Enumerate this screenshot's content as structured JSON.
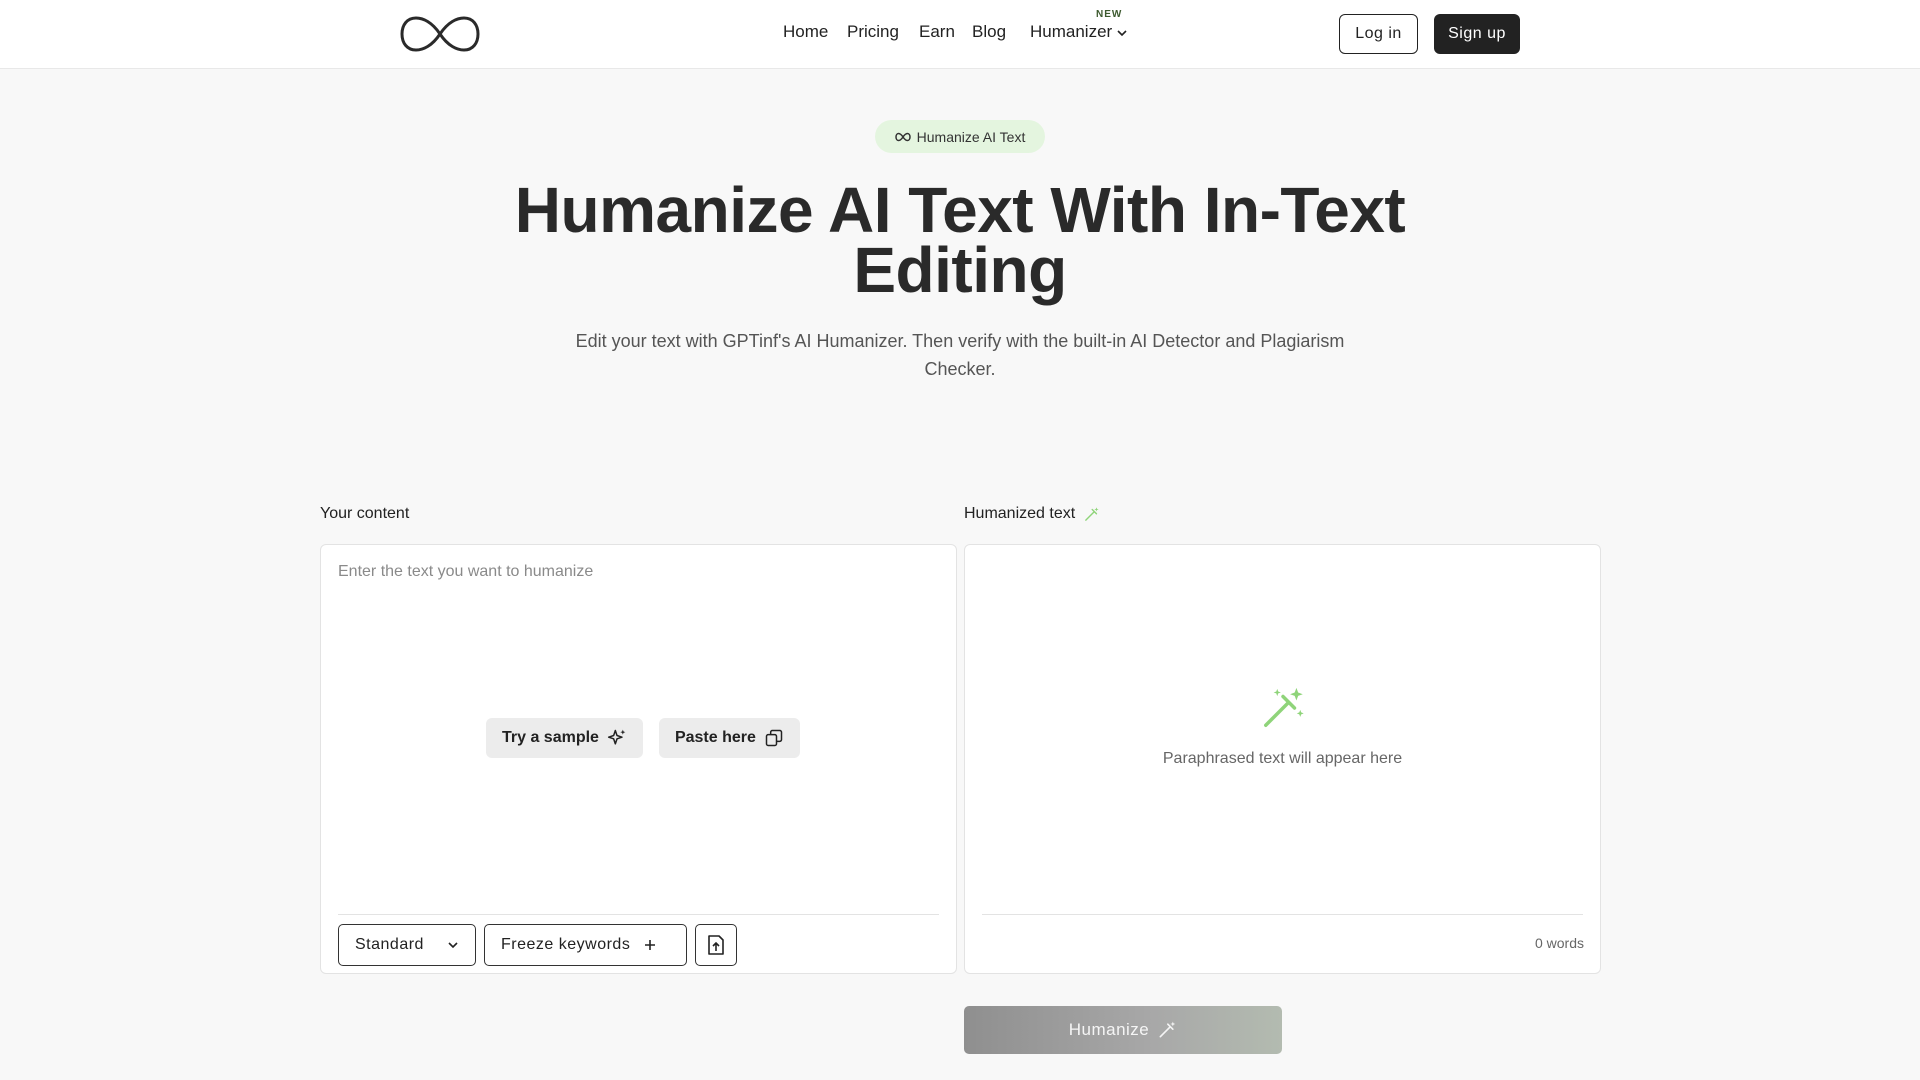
{
  "header": {
    "nav": [
      {
        "label": "Home"
      },
      {
        "label": "Pricing"
      },
      {
        "label": "Earn"
      },
      {
        "label": "Blog"
      },
      {
        "label": "Humanizer"
      }
    ],
    "new_badge": "NEW",
    "login_label": "Log in",
    "signup_label": "Sign up"
  },
  "hero": {
    "badge": "Humanize AI Text",
    "title": "Humanize AI Text With In-Text Editing",
    "subtitle": "Edit your text with GPTinf's AI Humanizer. Then verify with the built-in AI Detector and Plagiarism Checker."
  },
  "input": {
    "label": "Your content",
    "placeholder": "Enter the text you want to humanize",
    "try_sample": "Try a sample",
    "paste_here": "Paste here",
    "mode": "Standard",
    "freeze_keywords": "Freeze keywords"
  },
  "output": {
    "label": "Humanized text",
    "empty_text": "Paraphrased text will appear here",
    "word_count": "0 words"
  },
  "humanize_button": "Humanize",
  "colors": {
    "accent_green": "#8fd47a",
    "badge_bg": "#e4f5df",
    "dark": "#222222"
  },
  "icons": [
    "infinity-logo-icon",
    "chevron-down-icon",
    "infinity-icon",
    "magic-wand-icon",
    "sparkle-icon",
    "copy-icon",
    "plus-icon",
    "upload-file-icon"
  ]
}
